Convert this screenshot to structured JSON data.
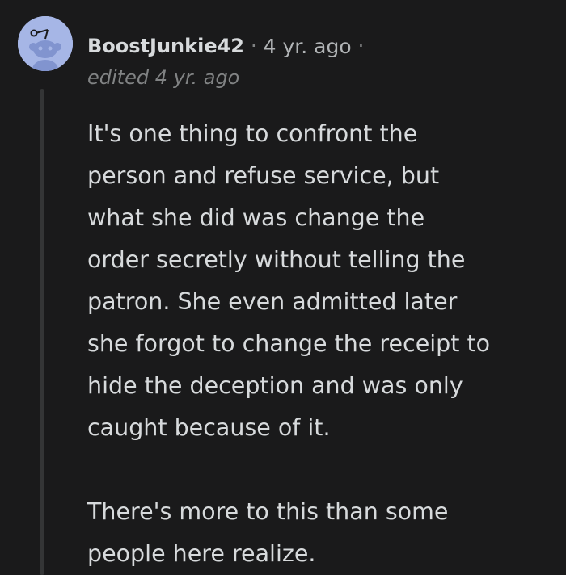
{
  "comment": {
    "author": "BoostJunkie42",
    "separator": "·",
    "timestamp": "4 yr. ago",
    "edited": "edited 4 yr. ago",
    "avatar_icon": "reddit-snoo-avatar-icon",
    "avatar_color": "#a6b6e6",
    "paragraphs": [
      {
        "lines": [
          "It's one thing to confront the",
          "person and refuse service, but",
          "what she did was change the",
          "order secretly without telling the",
          "patron. She even admitted later",
          "she forgot to change the receipt to",
          "hide the deception and was only",
          "caught because of it."
        ]
      },
      {
        "lines": [
          "There's more to this than some",
          "people here realize."
        ]
      }
    ]
  }
}
